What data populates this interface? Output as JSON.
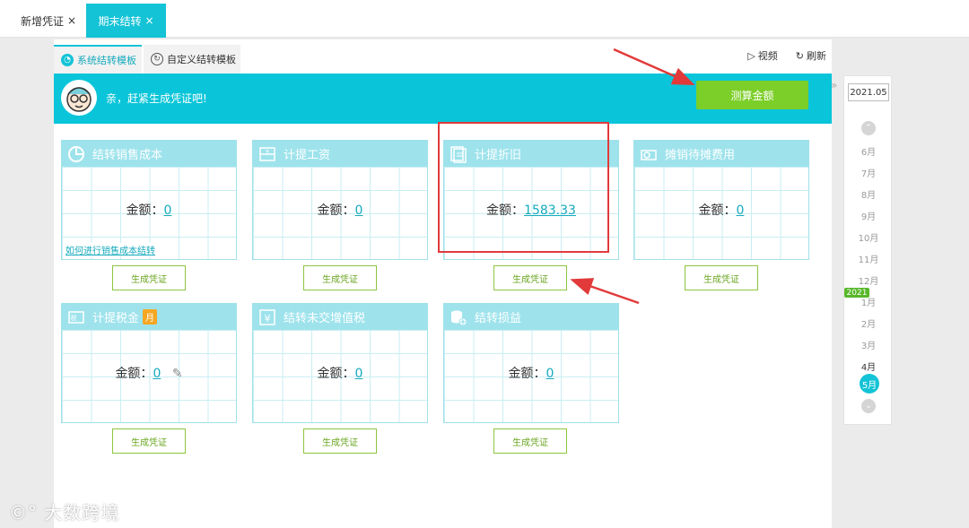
{
  "top_tabs": [
    {
      "label": "新增凭证",
      "close": "×"
    },
    {
      "label": "期末结转",
      "close": "×"
    }
  ],
  "sub_tabs": [
    {
      "label": "系统结转模板",
      "icon": "system-template-icon"
    },
    {
      "label": "自定义结转模板",
      "icon": "custom-template-icon"
    }
  ],
  "actions": {
    "video": "视频",
    "refresh": "刷新"
  },
  "banner": {
    "message": "亲，赶紧生成凭证吧!",
    "calc_button": "测算金额"
  },
  "cards": [
    {
      "title": "结转销售成本",
      "amount_label": "金额：",
      "amount": "0",
      "link": "如何进行销售成本结转",
      "button": "生成凭证"
    },
    {
      "title": "计提工资",
      "amount_label": "金额：",
      "amount": "0",
      "button": "生成凭证"
    },
    {
      "title": "计提折旧",
      "amount_label": "金额：",
      "amount": "1583.33",
      "button": "生成凭证"
    },
    {
      "title": "摊销待摊费用",
      "amount_label": "金额：",
      "amount": "0",
      "button": "生成凭证"
    },
    {
      "title": "计提税金",
      "badge": "月",
      "amount_label": "金额：",
      "amount": "0",
      "button": "生成凭证"
    },
    {
      "title": "结转未交增值税",
      "amount_label": "金额：",
      "amount": "0",
      "button": "生成凭证"
    },
    {
      "title": "结转损益",
      "amount_label": "金额：",
      "amount": "0",
      "button": "生成凭证"
    }
  ],
  "period": {
    "current": "2021.05",
    "year_tag": "2021",
    "months": [
      "6月",
      "7月",
      "8月",
      "9月",
      "10月",
      "11月",
      "12月",
      "1月",
      "2月",
      "3月",
      "4月",
      "5月"
    ],
    "selected": "5月"
  },
  "watermark": "大数跨境",
  "colors": {
    "accent": "#14c3d6",
    "green": "#7cce29",
    "card_head": "#9ee3ec",
    "highlight": "#e23a3a"
  }
}
